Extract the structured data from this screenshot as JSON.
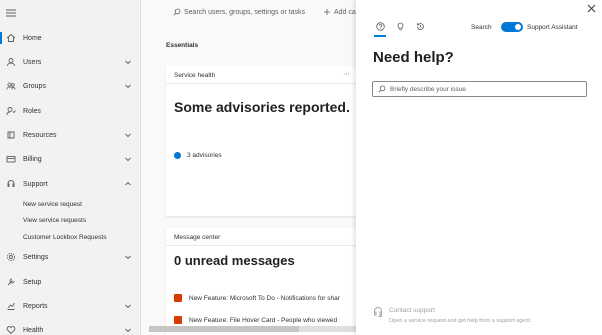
{
  "nav": {
    "items": [
      {
        "label": "Home",
        "icon": "home-icon"
      },
      {
        "label": "Users",
        "icon": "user-icon"
      },
      {
        "label": "Groups",
        "icon": "groups-icon"
      },
      {
        "label": "Roles",
        "icon": "roles-icon"
      },
      {
        "label": "Resources",
        "icon": "resources-icon"
      },
      {
        "label": "Billing",
        "icon": "billing-icon"
      },
      {
        "label": "Support",
        "icon": "support-icon"
      },
      {
        "label": "Settings",
        "icon": "gear-icon"
      },
      {
        "label": "Setup",
        "icon": "setup-icon"
      },
      {
        "label": "Reports",
        "icon": "reports-icon"
      },
      {
        "label": "Health",
        "icon": "health-icon"
      }
    ],
    "support_sub": [
      "New service request",
      "View service requests",
      "Customer Lockbox Requests"
    ]
  },
  "topbar": {
    "search_placeholder": "Search users, groups, settings or tasks",
    "add_label": "Add ca"
  },
  "main": {
    "essentials": "Essentials",
    "service_health": {
      "title": "Service health",
      "heading": "Some advisories reported.",
      "advisories": "3 advisories"
    },
    "message_center": {
      "title": "Message center",
      "heading": "0 unread messages",
      "messages": [
        "New Feature: Microsoft To Do - Notifications for shar",
        "New Feature: File Hover Card - People who viewed"
      ]
    }
  },
  "help_panel": {
    "search_tab": "Search",
    "support_assistant": "Support Assistant",
    "title": "Need help?",
    "input_placeholder": "Briefly describe your issue",
    "contact_title": "Contact support",
    "contact_desc": "Open a service request and get help from a support agent."
  },
  "colors": {
    "accent": "#0078d4",
    "office_icon": "#d83b01"
  }
}
